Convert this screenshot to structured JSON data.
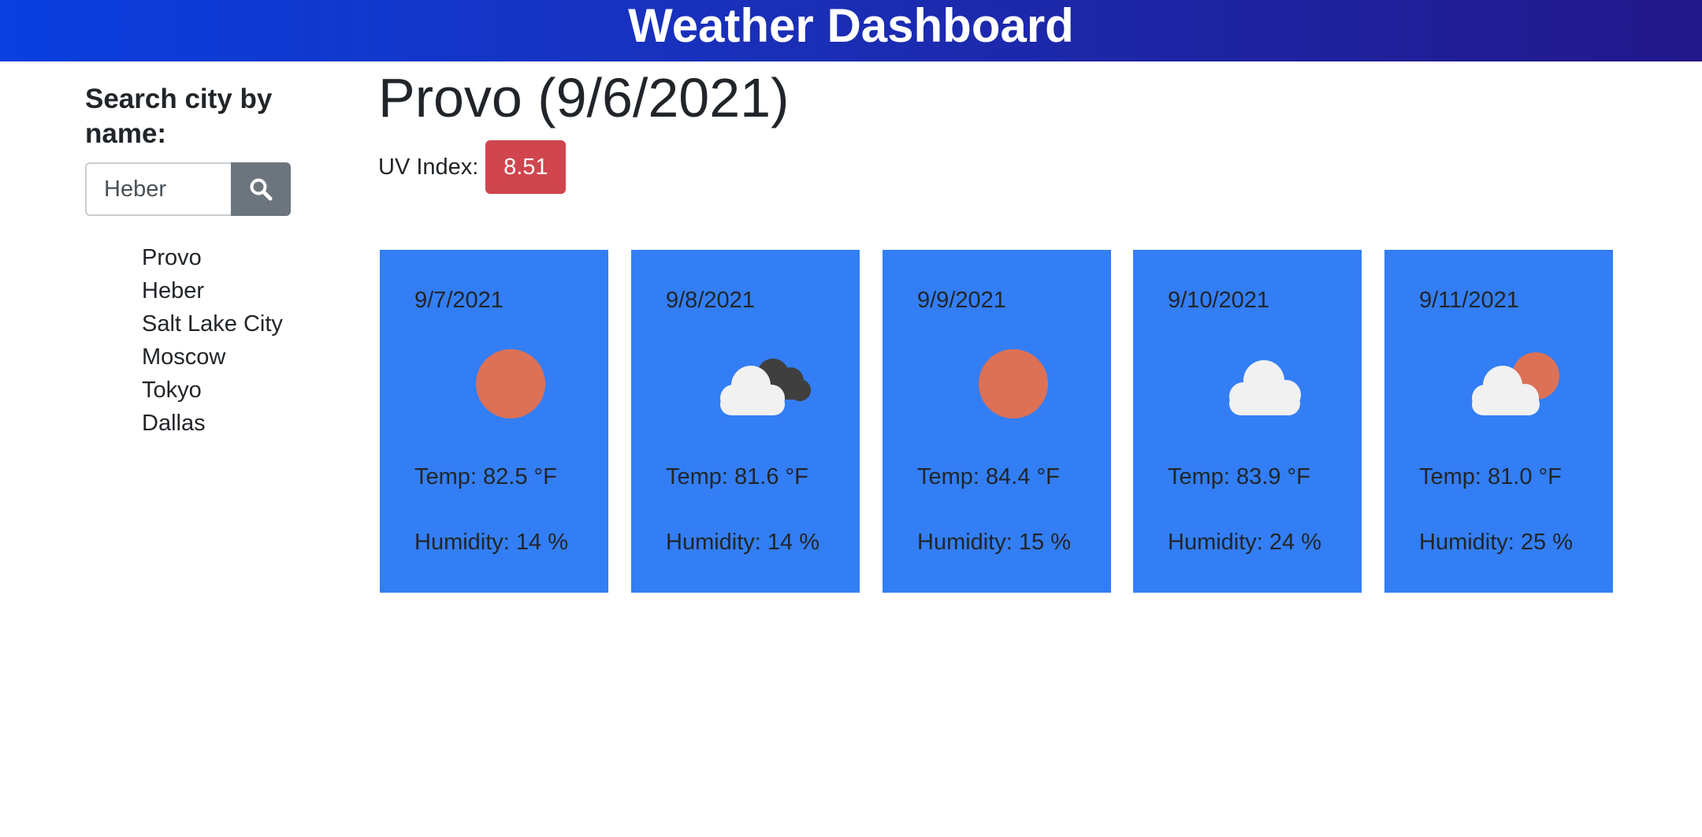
{
  "header": {
    "title": "Weather Dashboard"
  },
  "sidebar": {
    "search_label": "Search city by name:",
    "search_value": "Heber",
    "search_button_icon": "search-icon",
    "history": [
      "Provo",
      "Heber",
      "Salt Lake City",
      "Moscow",
      "Tokyo",
      "Dallas"
    ]
  },
  "current": {
    "title": "Provo (9/6/2021)",
    "uv_label": "UV Index:",
    "uv_value": "8.51",
    "uv_color": "#d0454e"
  },
  "forecast": [
    {
      "date": "9/7/2021",
      "icon": "sun-icon",
      "temp": "Temp: 82.5 °F",
      "humidity": "Humidity: 14 %"
    },
    {
      "date": "9/8/2021",
      "icon": "broken-clouds-icon",
      "temp": "Temp: 81.6 °F",
      "humidity": "Humidity: 14 %"
    },
    {
      "date": "9/9/2021",
      "icon": "sun-icon",
      "temp": "Temp: 84.4 °F",
      "humidity": "Humidity: 15 %"
    },
    {
      "date": "9/10/2021",
      "icon": "cloud-icon",
      "temp": "Temp: 83.9 °F",
      "humidity": "Humidity: 24 %"
    },
    {
      "date": "9/11/2021",
      "icon": "partly-cloudy-icon",
      "temp": "Temp: 81.0 °F",
      "humidity": "Humidity: 25 %"
    }
  ],
  "colors": {
    "header_start": "#0a3fe0",
    "header_end": "#22178a",
    "card": "#337ef4",
    "search_button": "#6c757d",
    "sun": "#dc7156",
    "cloud": "#f1f1f1",
    "dark_cloud": "#3f3f3f"
  }
}
